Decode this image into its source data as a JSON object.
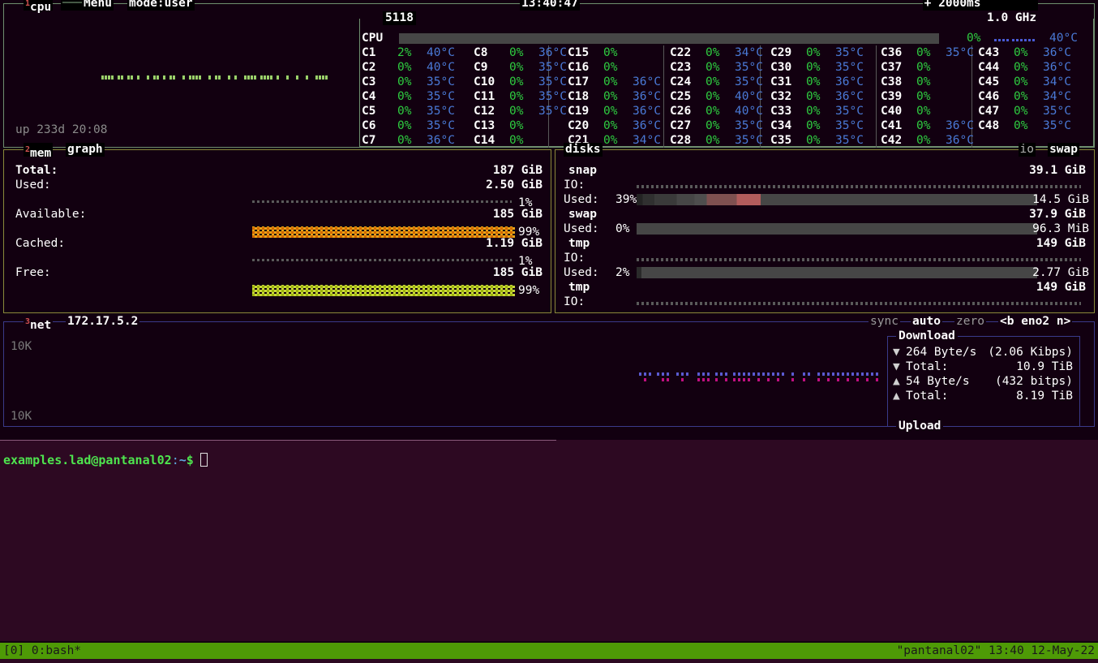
{
  "cpu": {
    "title_num": "1",
    "title": "cpu",
    "menu_label": "Menu",
    "mode_label": "mode:user",
    "clock": "13:40:47",
    "update_plus": "+",
    "update_ms": "2000ms",
    "update_minus": "-",
    "freq": "1.0 GHz",
    "box_title": "5118",
    "uptime": "up 233d 20:08",
    "total_name": "CPU",
    "total_pct": "0%",
    "total_temp": "40°C",
    "cores": [
      {
        "name": "C1",
        "pct": "2%",
        "temp": "40°C"
      },
      {
        "name": "C2",
        "pct": "0%",
        "temp": "40°C"
      },
      {
        "name": "C3",
        "pct": "0%",
        "temp": "35°C"
      },
      {
        "name": "C4",
        "pct": "0%",
        "temp": "35°C"
      },
      {
        "name": "C5",
        "pct": "0%",
        "temp": "35°C"
      },
      {
        "name": "C6",
        "pct": "0%",
        "temp": "35°C"
      },
      {
        "name": "C7",
        "pct": "0%",
        "temp": "36°C"
      },
      {
        "name": "C8",
        "pct": "0%",
        "temp": "36°C"
      },
      {
        "name": "C9",
        "pct": "0%",
        "temp": "35°C"
      },
      {
        "name": "C10",
        "pct": "0%",
        "temp": "35°C"
      },
      {
        "name": "C11",
        "pct": "0%",
        "temp": "35°C"
      },
      {
        "name": "C12",
        "pct": "0%",
        "temp": "35°C"
      },
      {
        "name": "C13",
        "pct": "0%",
        "temp": ""
      },
      {
        "name": "C14",
        "pct": "0%",
        "temp": ""
      },
      {
        "name": "C15",
        "pct": "0%",
        "temp": ""
      },
      {
        "name": "C16",
        "pct": "0%",
        "temp": ""
      },
      {
        "name": "C17",
        "pct": "0%",
        "temp": "36°C"
      },
      {
        "name": "C18",
        "pct": "0%",
        "temp": "36°C"
      },
      {
        "name": "C19",
        "pct": "0%",
        "temp": "36°C"
      },
      {
        "name": "C20",
        "pct": "0%",
        "temp": "36°C"
      },
      {
        "name": "C21",
        "pct": "0%",
        "temp": "34°C"
      },
      {
        "name": "C22",
        "pct": "0%",
        "temp": "34°C"
      },
      {
        "name": "C23",
        "pct": "0%",
        "temp": "35°C"
      },
      {
        "name": "C24",
        "pct": "0%",
        "temp": "35°C"
      },
      {
        "name": "C25",
        "pct": "0%",
        "temp": "40°C"
      },
      {
        "name": "C26",
        "pct": "0%",
        "temp": "40°C"
      },
      {
        "name": "C27",
        "pct": "0%",
        "temp": "35°C"
      },
      {
        "name": "C28",
        "pct": "0%",
        "temp": "35°C"
      },
      {
        "name": "C29",
        "pct": "0%",
        "temp": "35°C"
      },
      {
        "name": "C30",
        "pct": "0%",
        "temp": "35°C"
      },
      {
        "name": "C31",
        "pct": "0%",
        "temp": "36°C"
      },
      {
        "name": "C32",
        "pct": "0%",
        "temp": "36°C"
      },
      {
        "name": "C33",
        "pct": "0%",
        "temp": "35°C"
      },
      {
        "name": "C34",
        "pct": "0%",
        "temp": "35°C"
      },
      {
        "name": "C35",
        "pct": "0%",
        "temp": "35°C"
      },
      {
        "name": "C36",
        "pct": "0%",
        "temp": "35°C"
      },
      {
        "name": "C37",
        "pct": "0%",
        "temp": ""
      },
      {
        "name": "C38",
        "pct": "0%",
        "temp": ""
      },
      {
        "name": "C39",
        "pct": "0%",
        "temp": ""
      },
      {
        "name": "C40",
        "pct": "0%",
        "temp": ""
      },
      {
        "name": "C41",
        "pct": "0%",
        "temp": "36°C"
      },
      {
        "name": "C42",
        "pct": "0%",
        "temp": "36°C"
      },
      {
        "name": "C43",
        "pct": "0%",
        "temp": "36°C"
      },
      {
        "name": "C44",
        "pct": "0%",
        "temp": "36°C"
      },
      {
        "name": "C45",
        "pct": "0%",
        "temp": "34°C"
      },
      {
        "name": "C46",
        "pct": "0%",
        "temp": "34°C"
      },
      {
        "name": "C47",
        "pct": "0%",
        "temp": "35°C"
      },
      {
        "name": "C48",
        "pct": "0%",
        "temp": "35°C"
      }
    ]
  },
  "mem": {
    "title_num": "2",
    "title": "mem",
    "graph_label": "graph",
    "rows": [
      {
        "label": "Total:",
        "value": "187 GiB",
        "bold": true,
        "pct": null,
        "bar": null
      },
      {
        "label": "Used:",
        "value": "2.50 GiB",
        "bold": false,
        "pct": "1%",
        "bar": "dim"
      },
      {
        "label": "Available:",
        "value": "185 GiB",
        "bold": false,
        "pct": "99%",
        "bar": "orange"
      },
      {
        "label": "Cached:",
        "value": "1.19 GiB",
        "bold": false,
        "pct": "1%",
        "bar": "dim"
      },
      {
        "label": "Free:",
        "value": "185 GiB",
        "bold": false,
        "pct": "99%",
        "bar": "yellowgreen"
      }
    ]
  },
  "disks": {
    "title": "disks",
    "io_label": "io",
    "swap_label": "swap",
    "entries": [
      {
        "name": "snap",
        "total": "39.1 GiB",
        "io_label": "IO:",
        "used_label": "Used:",
        "used_pct": "39%",
        "used_value": "14.5 GiB",
        "fill": 39,
        "hot": true
      },
      {
        "name": "swap",
        "total": "37.9 GiB",
        "io_label": "",
        "used_label": "Used:",
        "used_pct": "0%",
        "used_value": "96.3 MiB",
        "fill": 0,
        "hot": false
      },
      {
        "name": "tmp",
        "total": "149 GiB",
        "io_label": "IO:",
        "used_label": "Used:",
        "used_pct": "2%",
        "used_value": "2.77 GiB",
        "fill": 2,
        "hot": false
      },
      {
        "name": "tmp",
        "total": "149 GiB",
        "io_label": "IO:",
        "used_label": "",
        "used_pct": "",
        "used_value": "",
        "fill": 0,
        "hot": false
      }
    ]
  },
  "net": {
    "title_num": "3",
    "title": "net",
    "address": "172.17.5.2",
    "sync_label": "sync",
    "auto_label": "auto",
    "zero_label": "zero",
    "iface_label": "<b eno2 n>",
    "scale_top": "10K",
    "scale_bottom": "10K",
    "download_label": "Download",
    "upload_label": "Upload",
    "down_arrow": "▼",
    "up_arrow": "▲",
    "rows": [
      {
        "dir": "down",
        "label": "264 Byte/s",
        "value": "(2.06 Kibps)"
      },
      {
        "dir": "down",
        "label": "Total:",
        "value": "10.9 TiB"
      },
      {
        "dir": "up",
        "label": "54 Byte/s",
        "value": "(432 bitps)"
      },
      {
        "dir": "up",
        "label": "Total:",
        "value": "8.19 TiB"
      }
    ]
  },
  "terminal": {
    "user": "examples.lad@pantanal02",
    "colon": ":",
    "path": "~",
    "dollar": "$"
  },
  "statusbar": {
    "left": "[0] 0:bash*",
    "right": "\"pantanal02\" 13:40 12-May-22"
  },
  "colors": {
    "accent_green": "#6f8f6f",
    "accent_yellow": "#8a8a3a",
    "accent_blue": "#3a3a8a",
    "status_green": "#4e9a06",
    "terminal_bg": "#2d0922",
    "mem_orange": "#e8a317",
    "mem_yellowgreen": "#c8d63a",
    "core_pct": "#2ecc40",
    "core_temp": "#4a79d6"
  }
}
